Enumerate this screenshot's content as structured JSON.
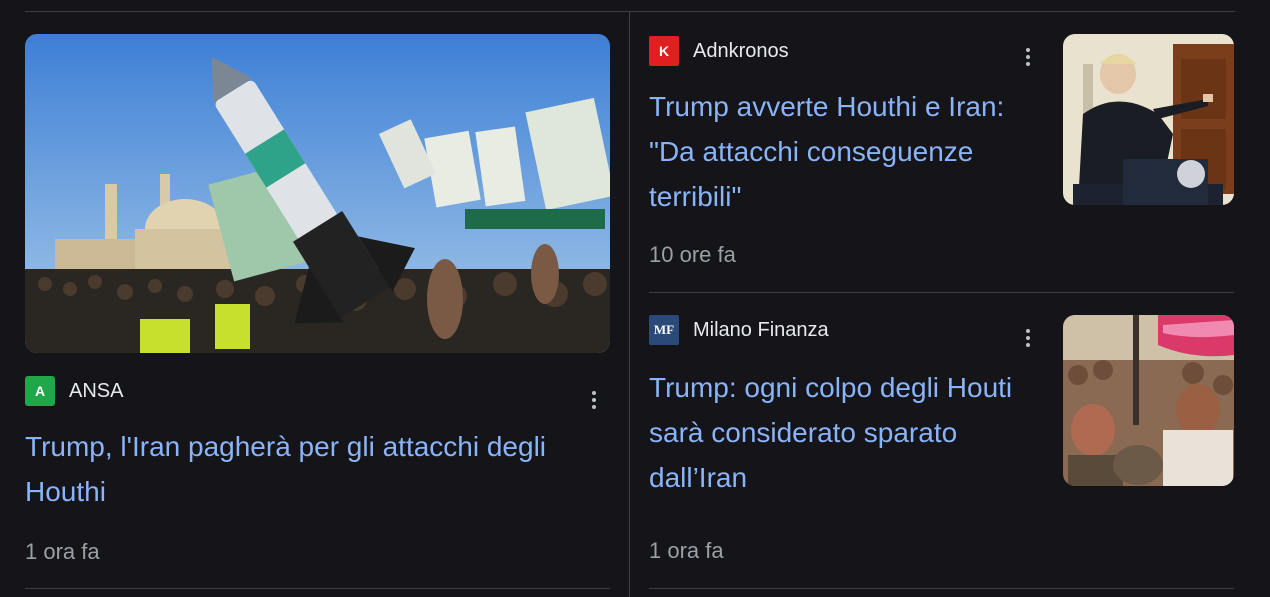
{
  "articles": [
    {
      "source": "ANSA",
      "favicon_text": "A",
      "favicon_color": "#1fa74a",
      "headline": "Trump, l'Iran pagherà per gli attacchi degli Houthi",
      "time": "1 ora fa"
    },
    {
      "source": "Adnkronos",
      "favicon_text": "K",
      "favicon_color": "#e02020",
      "headline": "Trump avverte Houthi e Iran: \"Da attacchi conseguenze terribili\"",
      "time": "10 ore fa"
    },
    {
      "source": "Milano Finanza",
      "favicon_text": "MF",
      "favicon_color": "#2b4a7a",
      "headline": "Trump: ogni colpo degli Houti sarà considerato sparato dall’Iran",
      "time": "1 ora fa"
    }
  ],
  "colors": {
    "background": "#141419",
    "link": "#8ab4f8",
    "muted": "#9aa0a6",
    "divider": "#3c4043"
  },
  "icons": {
    "menu": "more-vert-icon"
  }
}
